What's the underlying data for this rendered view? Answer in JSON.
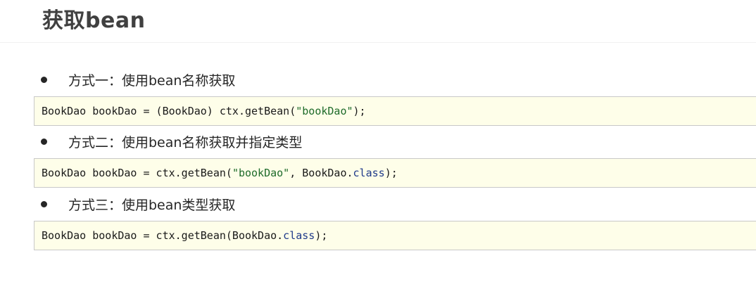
{
  "header": {
    "title": "获取bean"
  },
  "methods": [
    {
      "label": "方式一：使用bean名称获取",
      "code": {
        "prefix": "BookDao bookDao = (BookDao) ctx.getBean(",
        "string": "\"bookDao\"",
        "suffix": ");"
      }
    },
    {
      "label": "方式二：使用bean名称获取并指定类型",
      "code": {
        "prefix": "BookDao bookDao = ctx.getBean(",
        "string": "\"bookDao\"",
        "middle": ", BookDao.",
        "keyword": "class",
        "suffix": ");"
      }
    },
    {
      "label": "方式三：使用bean类型获取",
      "code": {
        "prefix": "BookDao bookDao = ctx.getBean(BookDao.",
        "keyword": "class",
        "suffix": ");"
      }
    }
  ],
  "colors": {
    "code_background": "#fefee9",
    "string_literal": "#1e6b2a",
    "keyword": "#1f3a8a"
  }
}
